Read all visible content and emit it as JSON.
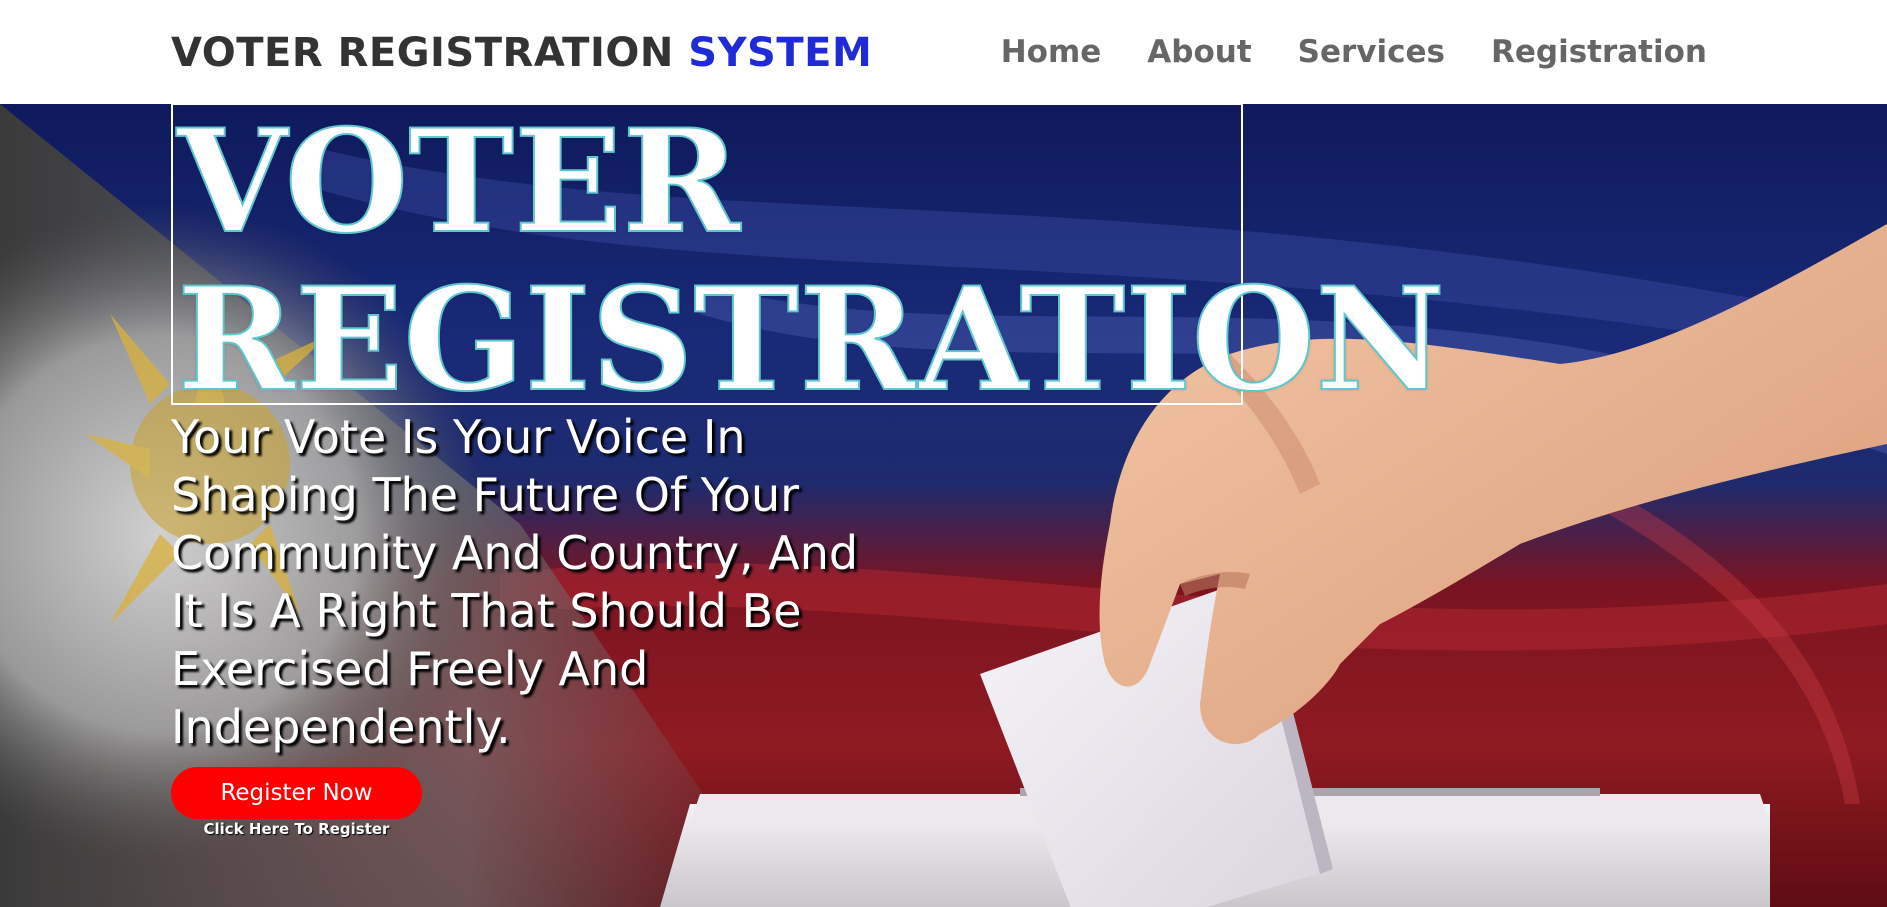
{
  "header": {
    "brand_main": "VOTER REGISTRATION",
    "brand_accent": "SYSTEM",
    "nav": [
      {
        "label": "Home"
      },
      {
        "label": "About"
      },
      {
        "label": "Services"
      },
      {
        "label": "Registration"
      }
    ]
  },
  "hero": {
    "headline_line1": "VOTER",
    "headline_line2": "REGISTRATION",
    "tagline": "Your Vote Is Your Voice In Shaping The Future Of Your Community And Country, And It Is A Right That Should Be Exercised Freely And Independently.",
    "cta_label": "Register Now",
    "cta_hint": "Click Here To Register",
    "background_image": "hand-dropping-ballot-into-box-over-philippine-flag"
  },
  "colors": {
    "brand_accent": "#1f2bd6",
    "cta": "#ff0000",
    "nav_text": "#666666"
  }
}
